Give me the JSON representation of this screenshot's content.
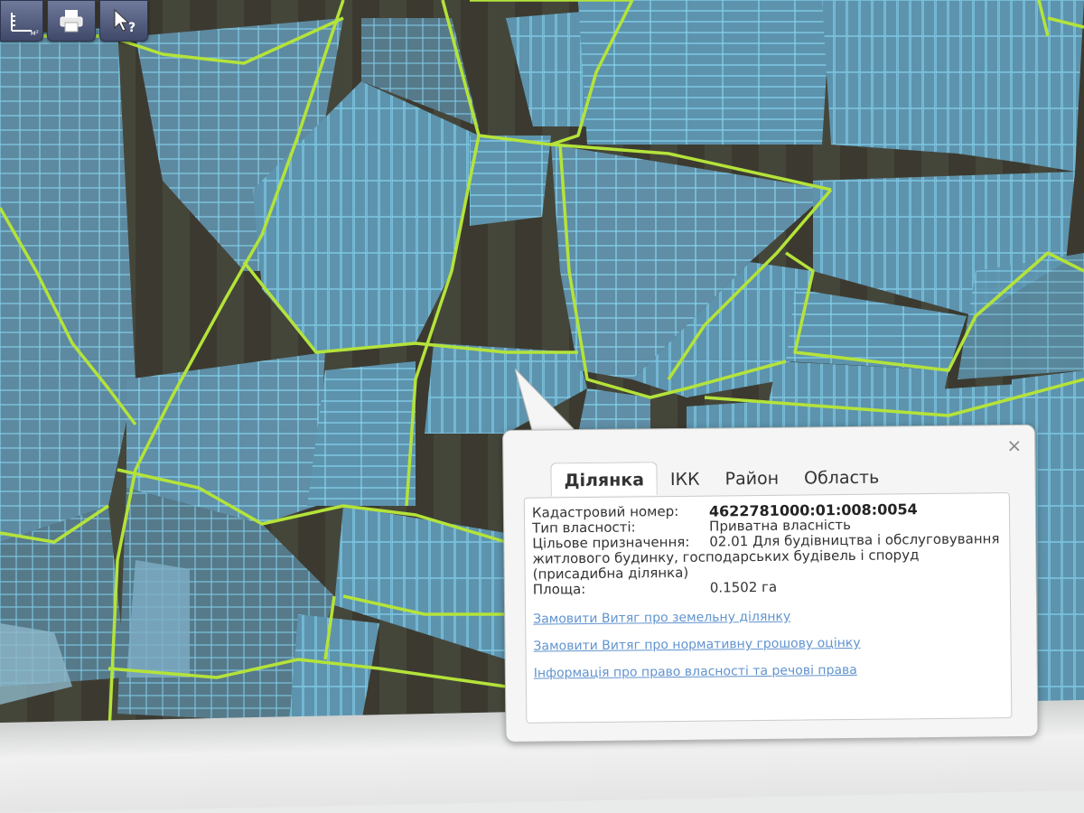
{
  "toolbar": {
    "buttons": [
      {
        "name": "measure-tool",
        "icon": "ruler-icon",
        "unit_label": "м²"
      },
      {
        "name": "print",
        "icon": "printer-icon"
      },
      {
        "name": "identify",
        "icon": "cursor-question-icon"
      }
    ]
  },
  "popup": {
    "close_label": "×",
    "tabs": [
      {
        "label": "Ділянка",
        "active": true
      },
      {
        "label": "ІКК",
        "active": false
      },
      {
        "label": "Район",
        "active": false
      },
      {
        "label": "Область",
        "active": false
      }
    ],
    "fields": {
      "cadastral_label": "Кадастровий номер:",
      "cadastral_value": "4622781000:01:008:0054",
      "ownership_label": "Тип власності:",
      "ownership_value": "Приватна власність",
      "purpose_label": "Цільове призначення:",
      "purpose_value": "02.01 Для будівництва і обслуговування житлового будинку, господарських будівель і споруд (присадибна ділянка)",
      "area_label": "Площа:",
      "area_value": "0.1502 га"
    },
    "links": [
      "Замовити Витяг про земельну ділянку",
      "Замовити Витяг про нормативну грошову оцінку",
      "Інформація про право власності та речові права"
    ]
  },
  "colors": {
    "parcel_outline": "#7fd3f2",
    "boundary_line": "#b4e33a",
    "link": "#2c6fbf"
  }
}
